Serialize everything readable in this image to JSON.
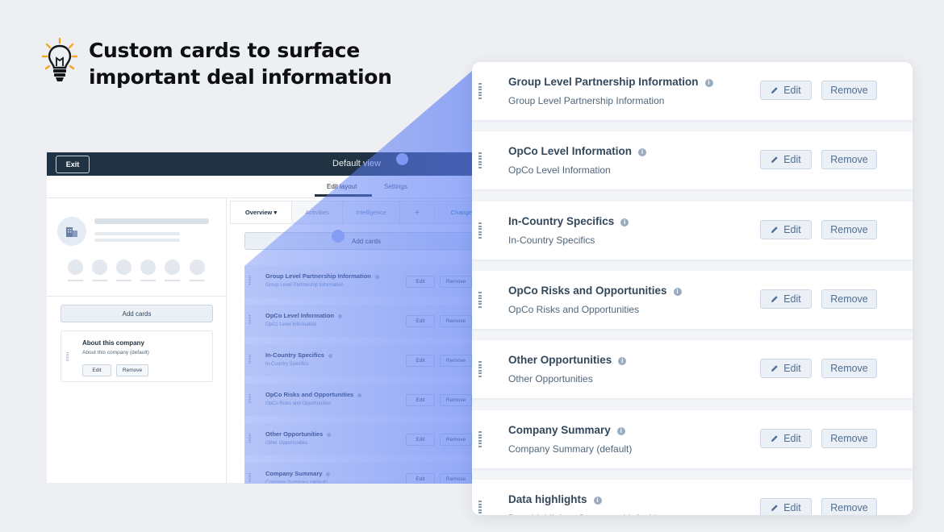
{
  "headline": {
    "line1": "Custom cards to surface",
    "line2": "important deal information",
    "icon": "lightbulb-icon"
  },
  "app": {
    "exit_label": "Exit",
    "view_title": "Default view",
    "subtabs": [
      "Edit layout",
      "Settings"
    ],
    "tabs": [
      "Overview ▾",
      "Activities",
      "Intelligence",
      "+",
      "Change t"
    ],
    "add_cards_label": "Add cards",
    "left_card": {
      "title": "About this company",
      "subtitle": "About this company (default)",
      "edit_label": "Edit",
      "remove_label": "Remove"
    },
    "cards": [
      {
        "title": "Group Level Partnership Information",
        "subtitle": "Group Level Partnership Information"
      },
      {
        "title": "OpCo Level Information",
        "subtitle": "OpCo Level Information"
      },
      {
        "title": "In-Country Specifics",
        "subtitle": "In-Country Specifics"
      },
      {
        "title": "OpCo Risks and Opportunities",
        "subtitle": "OpCo Risks and Opportunities"
      },
      {
        "title": "Other Opportunities",
        "subtitle": "Other Opportunities"
      },
      {
        "title": "Company Summary",
        "subtitle": "Company Summary (default)"
      }
    ],
    "edit_label": "Edit",
    "remove_label": "Remove"
  },
  "panel": {
    "edit_label": "Edit",
    "remove_label": "Remove",
    "cards": [
      {
        "title": "Group Level Partnership Information",
        "subtitle": "Group Level Partnership Information"
      },
      {
        "title": "OpCo Level Information",
        "subtitle": "OpCo Level Information"
      },
      {
        "title": "In-Country Specifics",
        "subtitle": "In-Country Specifics"
      },
      {
        "title": "OpCo Risks and Opportunities",
        "subtitle": "OpCo Risks and Opportunities"
      },
      {
        "title": "Other Opportunities",
        "subtitle": "Other Opportunities"
      },
      {
        "title": "Company Summary",
        "subtitle": "Company Summary (default)"
      },
      {
        "title": "Data highlights",
        "subtitle": "Data highlights: Company (default)"
      }
    ]
  },
  "colors": {
    "topbar": "#213343",
    "wedge": "#5b7cf6",
    "accent": "#f5a623"
  }
}
